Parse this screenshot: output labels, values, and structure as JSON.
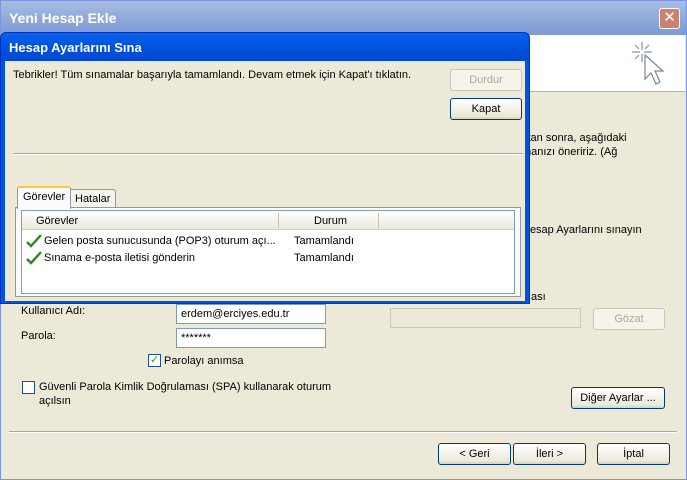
{
  "outer": {
    "title": "Yeni Hesap Ekle",
    "close": "✕",
    "bg_text_1": "ktan sonra, aşağıdaki",
    "bg_text_2": "manızı öneririz. (Ağ",
    "bg_text_3": "Hesap Ayarlarını sınayın",
    "bg_text_4": "ası",
    "username_label": "Kullanıcı Adı:",
    "username_value": "erdem@erciyes.edu.tr",
    "password_label": "Parola:",
    "password_value": "*******",
    "remember_label": "Parolayı anımsa",
    "spa_label_1": "Güvenli Parola Kimlik Doğrulaması (SPA) kullanarak oturum",
    "spa_label_2": "açılsın",
    "browse_button": "Gözat",
    "more_settings_button": "Diğer Ayarlar ...",
    "back_button": "< Geri",
    "next_button": "İleri >",
    "cancel_button": "İptal"
  },
  "dialog": {
    "title": "Hesap Ayarlarını Sına",
    "message": "Tebrikler! Tüm sınamalar başarıyla tamamlandı. Devam etmek için Kapat'ı tıklatın.",
    "stop_button": "Durdur",
    "close_button": "Kapat",
    "tabs": [
      "Görevler",
      "Hatalar"
    ],
    "columns": [
      "Görevler",
      "Durum"
    ],
    "rows": [
      {
        "task": "Gelen posta sunucusunda (POP3) oturum açı...",
        "status": "Tamamlandı"
      },
      {
        "task": "Sınama e-posta iletisi gönderin",
        "status": "Tamamlandı"
      }
    ]
  }
}
